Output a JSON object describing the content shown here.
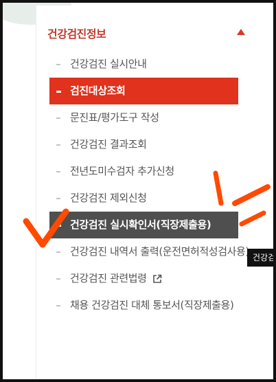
{
  "header": {
    "title": "건강검진정보",
    "collapse_icon": "triangle-up-icon",
    "accent_color": "#d93a25"
  },
  "menu": {
    "items": [
      {
        "label": "건강검진 실시안내",
        "state": "normal"
      },
      {
        "label": "검진대상조회",
        "state": "active"
      },
      {
        "label": "문진표/평가도구 작성",
        "state": "normal"
      },
      {
        "label": "건강검진 결과조회",
        "state": "normal"
      },
      {
        "label": "전년도미수검자 추가신청",
        "state": "normal"
      },
      {
        "label": "건강검진 제외신청",
        "state": "normal"
      },
      {
        "label": "건강검진 실시확인서(직장제출용)",
        "state": "hover"
      },
      {
        "label": "건강검진 내역서 출력(운전면허적성검사용)",
        "state": "normal"
      },
      {
        "label": "건강검진 관련법령",
        "state": "normal",
        "icon": "external-link-icon"
      },
      {
        "label": "채용 건강검진 대체 통보서(직장제출용)",
        "state": "normal"
      }
    ]
  },
  "tooltip": {
    "text": "건강검"
  },
  "colors": {
    "active_bg": "#e0321c",
    "hover_bg": "#4f4f4f",
    "annotation": "#ff4a00"
  }
}
